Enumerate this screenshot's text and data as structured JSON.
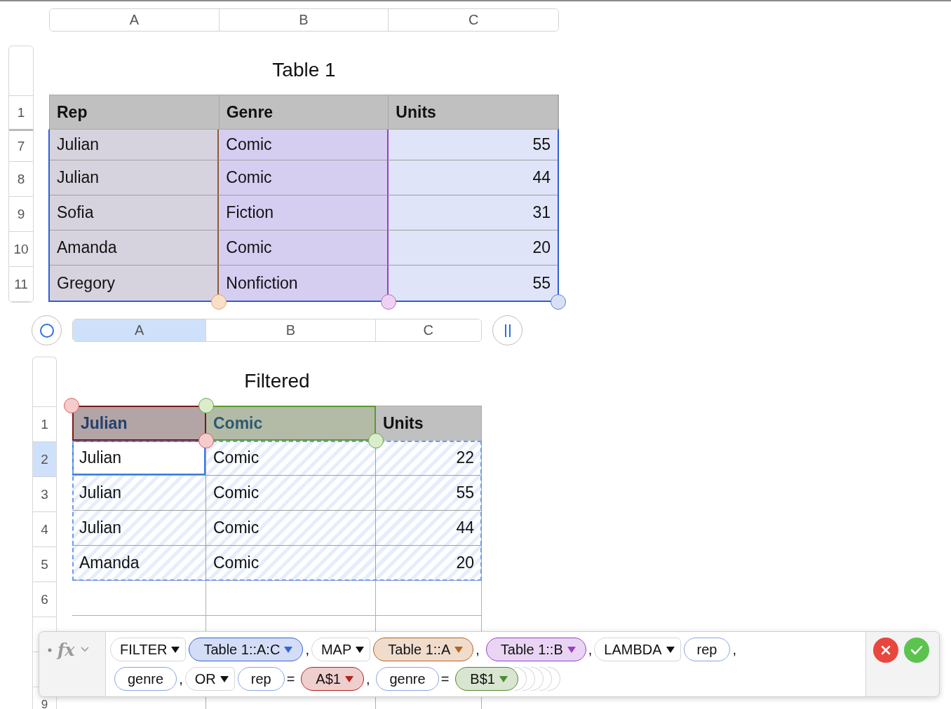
{
  "top_table": {
    "column_bar": [
      "A",
      "B",
      "C"
    ],
    "title": "Table 1",
    "row_numbers": [
      "1",
      "7",
      "8",
      "9",
      "10",
      "11"
    ],
    "header": [
      "Rep",
      "Genre",
      "Units"
    ],
    "rows": [
      [
        "Julian",
        "Comic",
        "55"
      ],
      [
        "Julian",
        "Comic",
        "44"
      ],
      [
        "Sofia",
        "Fiction",
        "31"
      ],
      [
        "Amanda",
        "Comic",
        "20"
      ],
      [
        "Gregory",
        "Nonfiction",
        "55"
      ]
    ]
  },
  "bottom_table": {
    "column_bar": [
      {
        "label": "A",
        "selected": true
      },
      {
        "label": "B",
        "selected": false
      },
      {
        "label": "C",
        "selected": false
      }
    ],
    "title": "Filtered",
    "row_numbers": [
      {
        "label": "1",
        "selected": false
      },
      {
        "label": "2",
        "selected": true
      },
      {
        "label": "3",
        "selected": false
      },
      {
        "label": "4",
        "selected": false
      },
      {
        "label": "5",
        "selected": false
      },
      {
        "label": "6",
        "selected": false
      }
    ],
    "row_number_below_bar": "9",
    "header": [
      "Julian",
      "Comic",
      "Units"
    ],
    "rows": [
      [
        "Julian",
        "Comic",
        "22"
      ],
      [
        "Julian",
        "Comic",
        "55"
      ],
      [
        "Julian",
        "Comic",
        "44"
      ],
      [
        "Amanda",
        "Comic",
        "20"
      ]
    ]
  },
  "formula_bar": {
    "fx_label": "fx",
    "lines": [
      [
        {
          "kind": "function",
          "text": "FILTER"
        },
        {
          "kind": "ref",
          "text": "Table 1::A:C",
          "color": "#3565d6"
        },
        {
          "kind": "sep",
          "text": ","
        },
        {
          "kind": "function",
          "text": "MAP"
        },
        {
          "kind": "ref",
          "text": "Table 1::A",
          "color": "#b8621b"
        },
        {
          "kind": "sep",
          "text": ","
        },
        {
          "kind": "ref",
          "text": "Table 1::B",
          "color": "#9a3ec8"
        },
        {
          "kind": "sep",
          "text": ","
        },
        {
          "kind": "function",
          "text": "LAMBDA"
        },
        {
          "kind": "name",
          "text": "rep"
        },
        {
          "kind": "sep",
          "text": ","
        }
      ],
      [
        {
          "kind": "name",
          "text": "genre"
        },
        {
          "kind": "sep",
          "text": ","
        },
        {
          "kind": "function",
          "text": "OR"
        },
        {
          "kind": "name",
          "text": "rep"
        },
        {
          "kind": "sep",
          "text": "="
        },
        {
          "kind": "ref",
          "text": "A$1",
          "color": "#b52020"
        },
        {
          "kind": "sep",
          "text": ","
        },
        {
          "kind": "name",
          "text": "genre"
        },
        {
          "kind": "sep",
          "text": "="
        },
        {
          "kind": "ref",
          "text": "B$1",
          "color": "#4e8a2e"
        },
        {
          "kind": "close"
        },
        {
          "kind": "close"
        },
        {
          "kind": "close"
        },
        {
          "kind": "close"
        },
        {
          "kind": "close"
        }
      ]
    ]
  }
}
